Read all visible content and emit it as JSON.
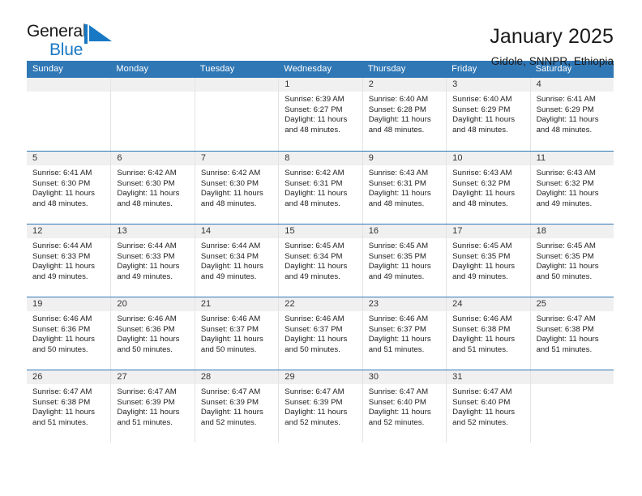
{
  "logo": {
    "text_top": "General",
    "text_bottom": "Blue",
    "mark": "blue-triangle-flag-icon",
    "color_top": "#1a1a1a",
    "color_bottom": "#1878c4"
  },
  "header": {
    "title": "January 2025",
    "subtitle": "Gidole, SNNPR, Ethiopia"
  },
  "theme": {
    "header_blue": "#3077b5",
    "date_band_gray": "#f0f0f0",
    "grid_line": "#e3e3e3",
    "text": "#222222"
  },
  "calendar": {
    "weekday_headers": [
      "Sunday",
      "Monday",
      "Tuesday",
      "Wednesday",
      "Thursday",
      "Friday",
      "Saturday"
    ],
    "labels": {
      "sunrise": "Sunrise:",
      "sunset": "Sunset:",
      "daylight": "Daylight:"
    },
    "weeks": [
      [
        {
          "empty": true
        },
        {
          "empty": true
        },
        {
          "empty": true
        },
        {
          "day": "1",
          "sunrise": "Sunrise: 6:39 AM",
          "sunset": "Sunset: 6:27 PM",
          "daylight_1": "Daylight: 11 hours",
          "daylight_2": "and 48 minutes."
        },
        {
          "day": "2",
          "sunrise": "Sunrise: 6:40 AM",
          "sunset": "Sunset: 6:28 PM",
          "daylight_1": "Daylight: 11 hours",
          "daylight_2": "and 48 minutes."
        },
        {
          "day": "3",
          "sunrise": "Sunrise: 6:40 AM",
          "sunset": "Sunset: 6:29 PM",
          "daylight_1": "Daylight: 11 hours",
          "daylight_2": "and 48 minutes."
        },
        {
          "day": "4",
          "sunrise": "Sunrise: 6:41 AM",
          "sunset": "Sunset: 6:29 PM",
          "daylight_1": "Daylight: 11 hours",
          "daylight_2": "and 48 minutes."
        }
      ],
      [
        {
          "day": "5",
          "sunrise": "Sunrise: 6:41 AM",
          "sunset": "Sunset: 6:30 PM",
          "daylight_1": "Daylight: 11 hours",
          "daylight_2": "and 48 minutes."
        },
        {
          "day": "6",
          "sunrise": "Sunrise: 6:42 AM",
          "sunset": "Sunset: 6:30 PM",
          "daylight_1": "Daylight: 11 hours",
          "daylight_2": "and 48 minutes."
        },
        {
          "day": "7",
          "sunrise": "Sunrise: 6:42 AM",
          "sunset": "Sunset: 6:30 PM",
          "daylight_1": "Daylight: 11 hours",
          "daylight_2": "and 48 minutes."
        },
        {
          "day": "8",
          "sunrise": "Sunrise: 6:42 AM",
          "sunset": "Sunset: 6:31 PM",
          "daylight_1": "Daylight: 11 hours",
          "daylight_2": "and 48 minutes."
        },
        {
          "day": "9",
          "sunrise": "Sunrise: 6:43 AM",
          "sunset": "Sunset: 6:31 PM",
          "daylight_1": "Daylight: 11 hours",
          "daylight_2": "and 48 minutes."
        },
        {
          "day": "10",
          "sunrise": "Sunrise: 6:43 AM",
          "sunset": "Sunset: 6:32 PM",
          "daylight_1": "Daylight: 11 hours",
          "daylight_2": "and 48 minutes."
        },
        {
          "day": "11",
          "sunrise": "Sunrise: 6:43 AM",
          "sunset": "Sunset: 6:32 PM",
          "daylight_1": "Daylight: 11 hours",
          "daylight_2": "and 49 minutes."
        }
      ],
      [
        {
          "day": "12",
          "sunrise": "Sunrise: 6:44 AM",
          "sunset": "Sunset: 6:33 PM",
          "daylight_1": "Daylight: 11 hours",
          "daylight_2": "and 49 minutes."
        },
        {
          "day": "13",
          "sunrise": "Sunrise: 6:44 AM",
          "sunset": "Sunset: 6:33 PM",
          "daylight_1": "Daylight: 11 hours",
          "daylight_2": "and 49 minutes."
        },
        {
          "day": "14",
          "sunrise": "Sunrise: 6:44 AM",
          "sunset": "Sunset: 6:34 PM",
          "daylight_1": "Daylight: 11 hours",
          "daylight_2": "and 49 minutes."
        },
        {
          "day": "15",
          "sunrise": "Sunrise: 6:45 AM",
          "sunset": "Sunset: 6:34 PM",
          "daylight_1": "Daylight: 11 hours",
          "daylight_2": "and 49 minutes."
        },
        {
          "day": "16",
          "sunrise": "Sunrise: 6:45 AM",
          "sunset": "Sunset: 6:35 PM",
          "daylight_1": "Daylight: 11 hours",
          "daylight_2": "and 49 minutes."
        },
        {
          "day": "17",
          "sunrise": "Sunrise: 6:45 AM",
          "sunset": "Sunset: 6:35 PM",
          "daylight_1": "Daylight: 11 hours",
          "daylight_2": "and 49 minutes."
        },
        {
          "day": "18",
          "sunrise": "Sunrise: 6:45 AM",
          "sunset": "Sunset: 6:35 PM",
          "daylight_1": "Daylight: 11 hours",
          "daylight_2": "and 50 minutes."
        }
      ],
      [
        {
          "day": "19",
          "sunrise": "Sunrise: 6:46 AM",
          "sunset": "Sunset: 6:36 PM",
          "daylight_1": "Daylight: 11 hours",
          "daylight_2": "and 50 minutes."
        },
        {
          "day": "20",
          "sunrise": "Sunrise: 6:46 AM",
          "sunset": "Sunset: 6:36 PM",
          "daylight_1": "Daylight: 11 hours",
          "daylight_2": "and 50 minutes."
        },
        {
          "day": "21",
          "sunrise": "Sunrise: 6:46 AM",
          "sunset": "Sunset: 6:37 PM",
          "daylight_1": "Daylight: 11 hours",
          "daylight_2": "and 50 minutes."
        },
        {
          "day": "22",
          "sunrise": "Sunrise: 6:46 AM",
          "sunset": "Sunset: 6:37 PM",
          "daylight_1": "Daylight: 11 hours",
          "daylight_2": "and 50 minutes."
        },
        {
          "day": "23",
          "sunrise": "Sunrise: 6:46 AM",
          "sunset": "Sunset: 6:37 PM",
          "daylight_1": "Daylight: 11 hours",
          "daylight_2": "and 51 minutes."
        },
        {
          "day": "24",
          "sunrise": "Sunrise: 6:46 AM",
          "sunset": "Sunset: 6:38 PM",
          "daylight_1": "Daylight: 11 hours",
          "daylight_2": "and 51 minutes."
        },
        {
          "day": "25",
          "sunrise": "Sunrise: 6:47 AM",
          "sunset": "Sunset: 6:38 PM",
          "daylight_1": "Daylight: 11 hours",
          "daylight_2": "and 51 minutes."
        }
      ],
      [
        {
          "day": "26",
          "sunrise": "Sunrise: 6:47 AM",
          "sunset": "Sunset: 6:38 PM",
          "daylight_1": "Daylight: 11 hours",
          "daylight_2": "and 51 minutes."
        },
        {
          "day": "27",
          "sunrise": "Sunrise: 6:47 AM",
          "sunset": "Sunset: 6:39 PM",
          "daylight_1": "Daylight: 11 hours",
          "daylight_2": "and 51 minutes."
        },
        {
          "day": "28",
          "sunrise": "Sunrise: 6:47 AM",
          "sunset": "Sunset: 6:39 PM",
          "daylight_1": "Daylight: 11 hours",
          "daylight_2": "and 52 minutes."
        },
        {
          "day": "29",
          "sunrise": "Sunrise: 6:47 AM",
          "sunset": "Sunset: 6:39 PM",
          "daylight_1": "Daylight: 11 hours",
          "daylight_2": "and 52 minutes."
        },
        {
          "day": "30",
          "sunrise": "Sunrise: 6:47 AM",
          "sunset": "Sunset: 6:40 PM",
          "daylight_1": "Daylight: 11 hours",
          "daylight_2": "and 52 minutes."
        },
        {
          "day": "31",
          "sunrise": "Sunrise: 6:47 AM",
          "sunset": "Sunset: 6:40 PM",
          "daylight_1": "Daylight: 11 hours",
          "daylight_2": "and 52 minutes."
        },
        {
          "empty": true
        }
      ]
    ]
  }
}
